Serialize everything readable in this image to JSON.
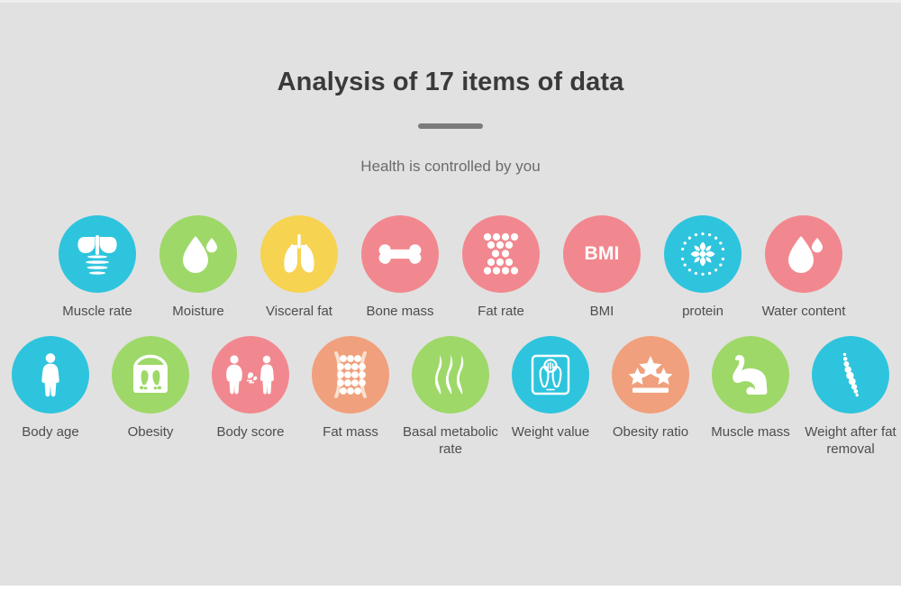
{
  "header": {
    "title": "Analysis of 17 items of data",
    "subtitle": "Health is controlled by you"
  },
  "colors": {
    "background": "#e2e1e1",
    "page_background": "#ffffff",
    "title_text": "#3a3a3a",
    "subtitle_text": "#6b6b6b",
    "label_text": "#4d4d4d",
    "divider": "#7b7b7b",
    "cyan": "#2ec4dd",
    "green": "#9ed868",
    "yellow": "#f6d351",
    "pink": "#f2888f",
    "orange": "#f0a07c",
    "icon_white": "#ffffff"
  },
  "rows": [
    {
      "items": [
        {
          "label": "Muscle rate",
          "icon": "torso-ribcage-icon",
          "color": "#2ec4dd"
        },
        {
          "label": "Moisture",
          "icon": "water-drop-icon",
          "color": "#9ed868"
        },
        {
          "label": "Visceral fat",
          "icon": "lungs-icon",
          "color": "#f6d351"
        },
        {
          "label": "Bone mass",
          "icon": "bone-icon",
          "color": "#f2888f"
        },
        {
          "label": "Fat rate",
          "icon": "fat-cells-hourglass-icon",
          "color": "#f2888f"
        },
        {
          "label": "BMI",
          "icon": "bmi-text-icon",
          "color": "#f2888f"
        },
        {
          "label": "protein",
          "icon": "molecule-flower-icon",
          "color": "#2ec4dd"
        },
        {
          "label": "Water content",
          "icon": "water-drop-icon",
          "color": "#f2888f"
        }
      ]
    },
    {
      "items": [
        {
          "label": "Body age",
          "icon": "person-silhouette-icon",
          "color": "#2ec4dd"
        },
        {
          "label": "Obesity",
          "icon": "scale-footprints-icon",
          "color": "#9ed868"
        },
        {
          "label": "Body score",
          "icon": "two-body-shapes-icon",
          "color": "#f2888f"
        },
        {
          "label": "Fat mass",
          "icon": "fat-cells-cluster-icon",
          "color": "#f0a07c"
        },
        {
          "label": "Basal metabolic rate",
          "icon": "heat-waves-icon",
          "color": "#9ed868"
        },
        {
          "label": "Weight value",
          "icon": "weight-scale-outline-icon",
          "color": "#2ec4dd"
        },
        {
          "label": "Obesity ratio",
          "icon": "three-stars-icon",
          "color": "#f0a07c"
        },
        {
          "label": "Muscle mass",
          "icon": "flexed-bicep-icon",
          "color": "#9ed868"
        },
        {
          "label": "Weight after fat removal",
          "icon": "spine-beads-icon",
          "color": "#2ec4dd"
        }
      ]
    }
  ]
}
